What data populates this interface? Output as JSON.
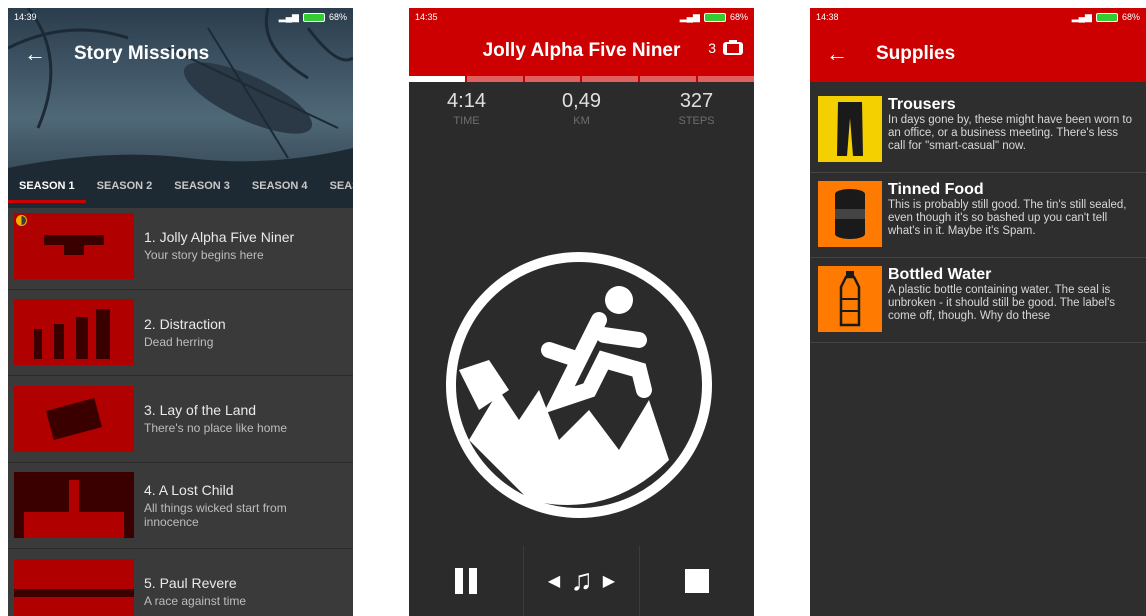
{
  "screen1": {
    "status": {
      "time": "14:39",
      "battery": "68%"
    },
    "title": "Story Missions",
    "tabs": [
      "SEASON 1",
      "SEASON 2",
      "SEASON 3",
      "SEASON 4",
      "SEAS"
    ],
    "missions": [
      {
        "title": "1. Jolly Alpha Five Niner",
        "subtitle": "Your story begins here"
      },
      {
        "title": "2. Distraction",
        "subtitle": "Dead herring"
      },
      {
        "title": "3. Lay of the Land",
        "subtitle": "There's no place like home"
      },
      {
        "title": "4. A Lost Child",
        "subtitle": "All things wicked start from innocence"
      },
      {
        "title": "5. Paul Revere",
        "subtitle": "A race against time"
      }
    ]
  },
  "screen2": {
    "status": {
      "time": "14:35",
      "battery": "68%"
    },
    "title": "Jolly Alpha Five Niner",
    "lives": "3",
    "stats": [
      {
        "value": "4:14",
        "label": "TIME"
      },
      {
        "value": "0,49",
        "label": "KM"
      },
      {
        "value": "327",
        "label": "STEPS"
      }
    ],
    "progress_segments_filled": 1,
    "progress_segments_total": 6
  },
  "screen3": {
    "status": {
      "time": "14:38",
      "battery": "68%"
    },
    "title": "Supplies",
    "items": [
      {
        "title": "Trousers",
        "description": "In days gone by, these might have been worn to an office, or a business meeting. There's less call for \"smart-casual\" now.",
        "color": "#f5d000"
      },
      {
        "title": "Tinned Food",
        "description": "This is probably still good. The tin's still sealed, even though it's so bashed up you can't tell what's in it. Maybe it's Spam.",
        "color": "#ff7a00"
      },
      {
        "title": "Bottled Water",
        "description": "A plastic bottle containing water. The seal is unbroken - it should still be good. The label's come off, though. Why do these",
        "color": "#ff7a00"
      }
    ]
  },
  "colors": {
    "accent": "#cc0000",
    "background": "#2b2b2b"
  }
}
